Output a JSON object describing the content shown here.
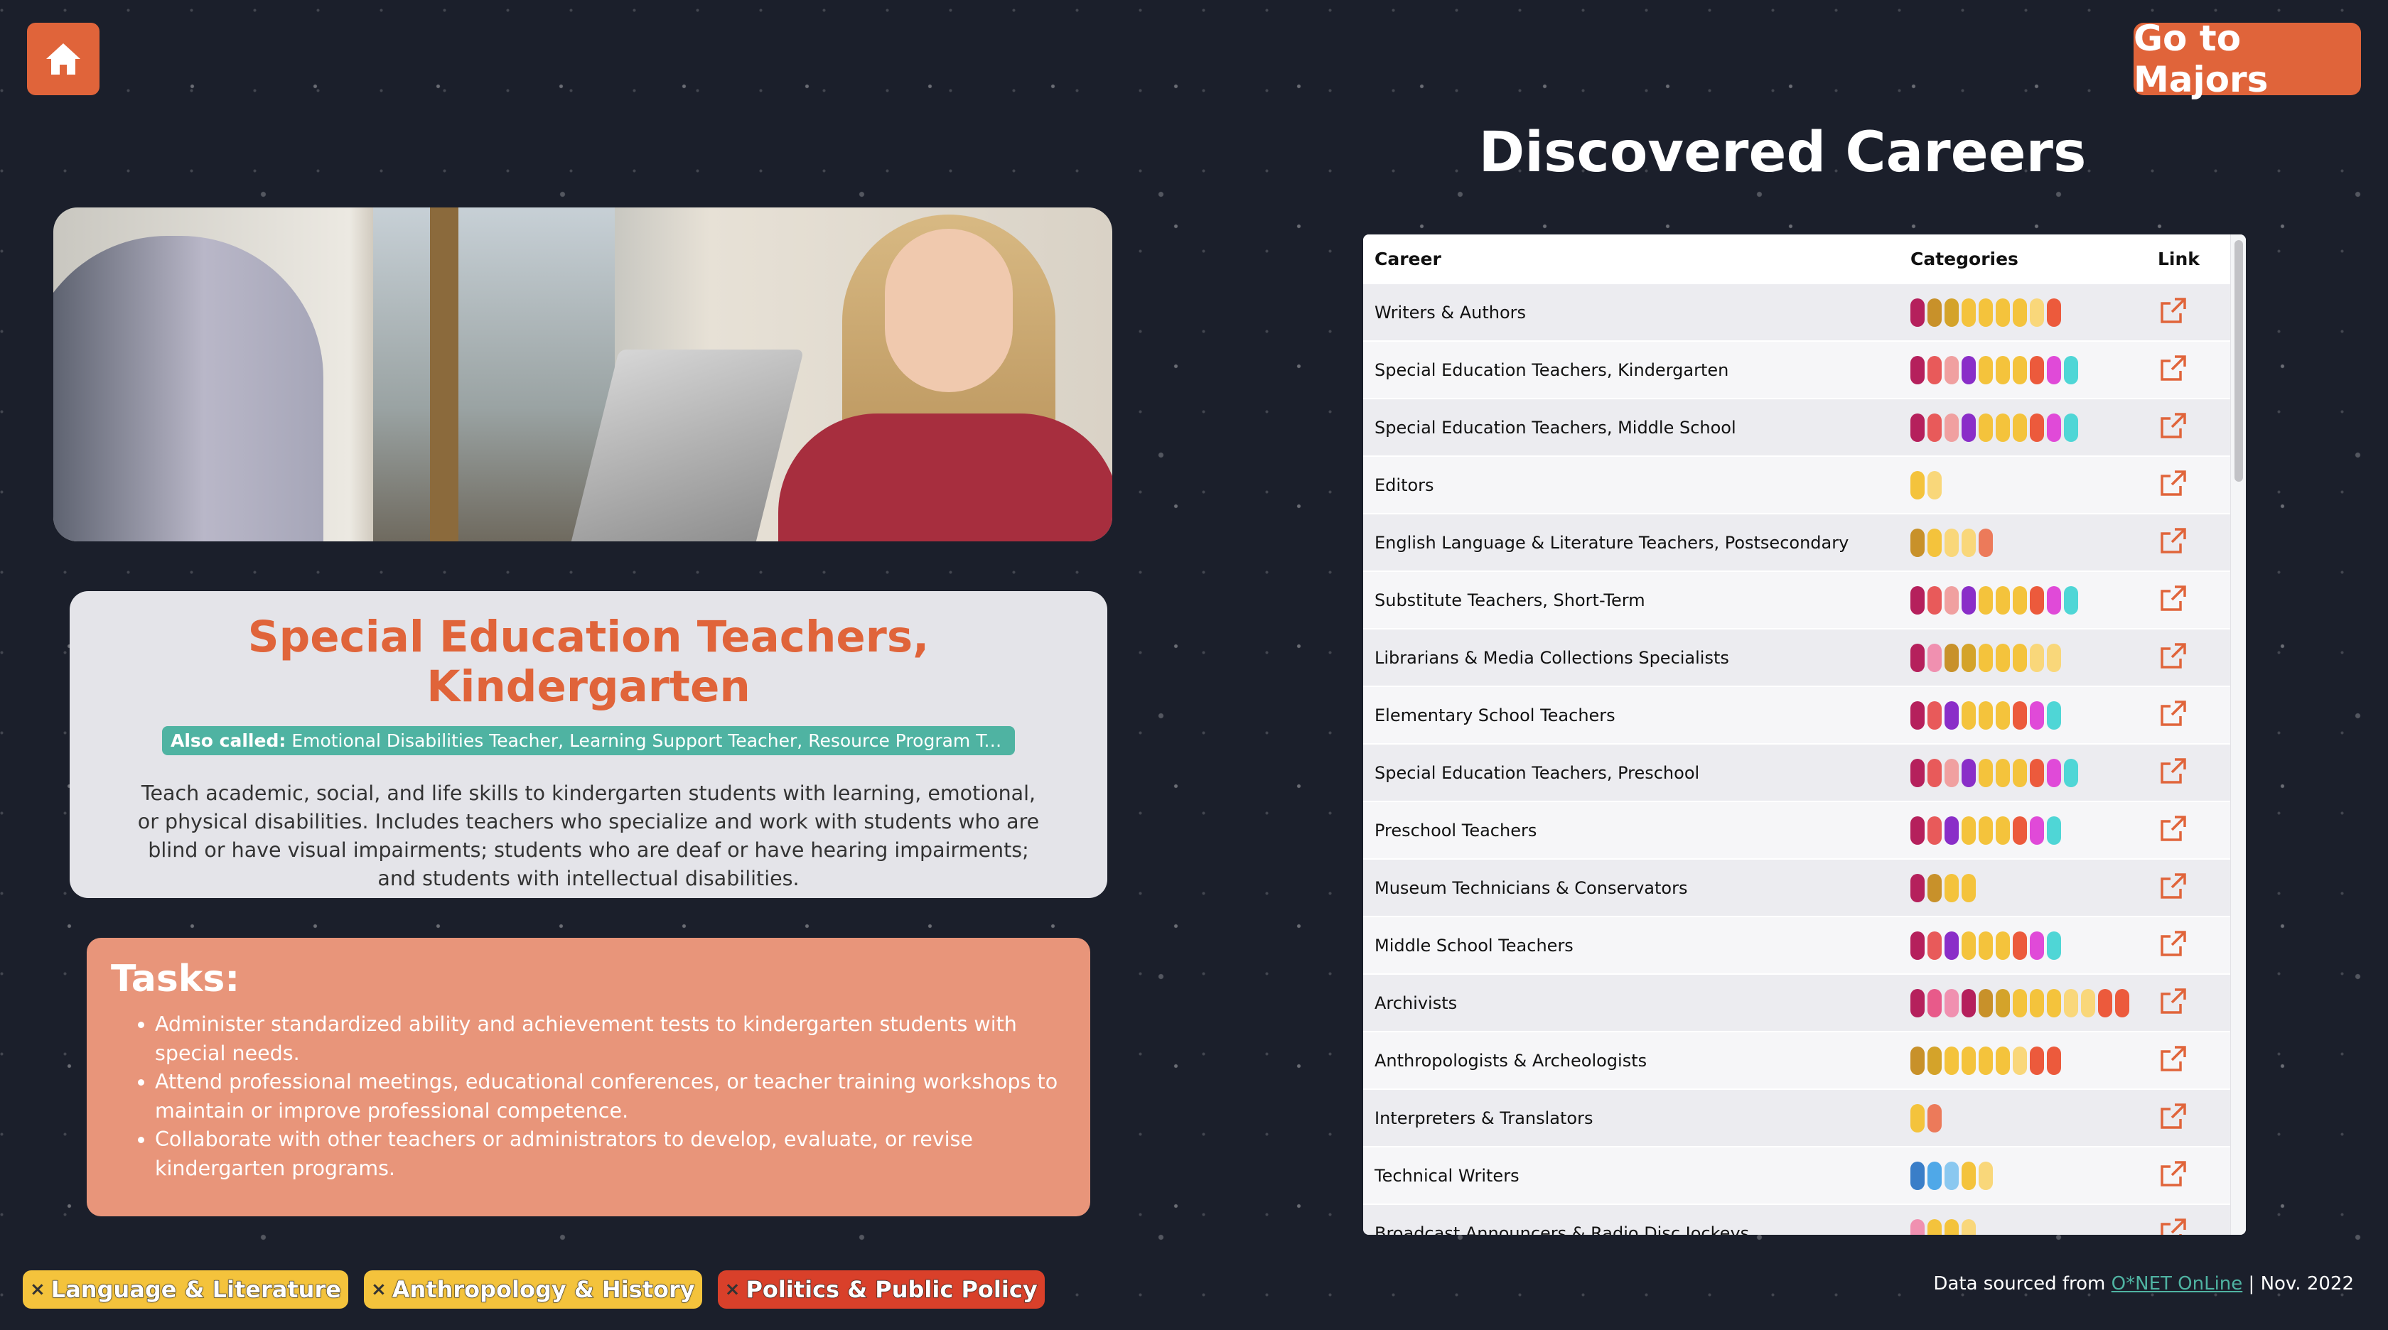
{
  "nav": {
    "home_icon": "home-icon",
    "majors_button": "Go to Majors"
  },
  "page_title": "Discovered Careers",
  "career": {
    "title": "Special Education Teachers, Kindergarten",
    "also_called_label": "Also called:",
    "also_called_value": "Emotional Disabilities Teacher, Learning Support Teacher, Resource Program Teacher...",
    "description": "Teach academic, social, and life skills to kindergarten students with learning, emotional, or physical disabilities. Includes teachers who specialize and work with students who are blind or have visual impairments; students who are deaf or have hearing impairments; and students with intellectual disabilities."
  },
  "tasks": {
    "title": "Tasks:",
    "items": [
      "Administer standardized ability and achievement tests to kindergarten students with special needs.",
      "Attend professional meetings, educational conferences, or teacher training workshops to maintain or improve professional competence.",
      "Collaborate with other teachers or administrators to develop, evaluate, or revise kindergarten programs."
    ]
  },
  "table": {
    "headers": {
      "career": "Career",
      "categories": "Categories",
      "link": "Link"
    },
    "link_icon": "external-link-icon",
    "rows": [
      {
        "career": "Writers & Authors",
        "pills": [
          "#b5205c",
          "#c8912a",
          "#d4a32a",
          "#f4c33c",
          "#f4c33c",
          "#f4c33c",
          "#f4c33c",
          "#f9d77a",
          "#ec5a3c"
        ]
      },
      {
        "career": "Special Education Teachers, Kindergarten",
        "pills": [
          "#b5205c",
          "#e85a5a",
          "#f0a0a0",
          "#8a2ec8",
          "#f4c33c",
          "#f4c33c",
          "#f4c33c",
          "#ec5a3c",
          "#e04ad8",
          "#4fd6d6"
        ]
      },
      {
        "career": "Special Education Teachers, Middle School",
        "pills": [
          "#b5205c",
          "#e85a5a",
          "#f0a0a0",
          "#8a2ec8",
          "#f4c33c",
          "#f4c33c",
          "#f4c33c",
          "#ec5a3c",
          "#e04ad8",
          "#4fd6d6"
        ]
      },
      {
        "career": "Editors",
        "pills": [
          "#f4c33c",
          "#f9d77a"
        ]
      },
      {
        "career": "English Language & Literature Teachers, Postsecondary",
        "pills": [
          "#c8912a",
          "#f4c33c",
          "#f9d77a",
          "#f9d77a",
          "#ec7a5a"
        ]
      },
      {
        "career": "Substitute Teachers, Short-Term",
        "pills": [
          "#b5205c",
          "#e85a5a",
          "#f0a0a0",
          "#8a2ec8",
          "#f4c33c",
          "#f4c33c",
          "#f4c33c",
          "#ec5a3c",
          "#e04ad8",
          "#4fd6d6"
        ]
      },
      {
        "career": "Librarians & Media Collections Specialists",
        "pills": [
          "#b5205c",
          "#f090b0",
          "#c8912a",
          "#d4a32a",
          "#f4c33c",
          "#f4c33c",
          "#f4c33c",
          "#f9d77a",
          "#f9d77a"
        ]
      },
      {
        "career": "Elementary School Teachers",
        "pills": [
          "#b5205c",
          "#e85a5a",
          "#8a2ec8",
          "#f4c33c",
          "#f4c33c",
          "#f4c33c",
          "#ec5a3c",
          "#e04ad8",
          "#4fd6d6"
        ]
      },
      {
        "career": "Special Education Teachers, Preschool",
        "pills": [
          "#b5205c",
          "#e85a5a",
          "#f0a0a0",
          "#8a2ec8",
          "#f4c33c",
          "#f4c33c",
          "#f4c33c",
          "#ec5a3c",
          "#e04ad8",
          "#4fd6d6"
        ]
      },
      {
        "career": "Preschool Teachers",
        "pills": [
          "#b5205c",
          "#e85a5a",
          "#8a2ec8",
          "#f4c33c",
          "#f4c33c",
          "#f4c33c",
          "#ec5a3c",
          "#e04ad8",
          "#4fd6d6"
        ]
      },
      {
        "career": "Museum Technicians & Conservators",
        "pills": [
          "#b5205c",
          "#c8912a",
          "#f4c33c",
          "#f4c33c"
        ]
      },
      {
        "career": "Middle School Teachers",
        "pills": [
          "#b5205c",
          "#e85a5a",
          "#8a2ec8",
          "#f4c33c",
          "#f4c33c",
          "#f4c33c",
          "#ec5a3c",
          "#e04ad8",
          "#4fd6d6"
        ]
      },
      {
        "career": "Archivists",
        "pills": [
          "#b5205c",
          "#e85a8a",
          "#f090b0",
          "#b5205c",
          "#c8912a",
          "#d4a32a",
          "#f4c33c",
          "#f4c33c",
          "#f4c33c",
          "#f9d77a",
          "#f9d77a",
          "#ec5a3c",
          "#ec5a3c"
        ]
      },
      {
        "career": "Anthropologists & Archeologists",
        "pills": [
          "#c8912a",
          "#d4a32a",
          "#f4c33c",
          "#f4c33c",
          "#f4c33c",
          "#f4c33c",
          "#f9d77a",
          "#ec5a3c",
          "#ec5a3c"
        ]
      },
      {
        "career": "Interpreters & Translators",
        "pills": [
          "#f4c33c",
          "#ec7a5a"
        ]
      },
      {
        "career": "Technical Writers",
        "pills": [
          "#3a7ec8",
          "#4fa8e8",
          "#8ac8f0",
          "#f4c33c",
          "#f9d77a"
        ]
      },
      {
        "career": "Broadcast Announcers & Radio Disc Jockeys",
        "pills": [
          "#f090b0",
          "#f4c33c",
          "#f4c33c",
          "#f9d77a"
        ]
      }
    ]
  },
  "filters": [
    {
      "label": "Language & Literature",
      "color": "#f4c33c"
    },
    {
      "label": "Anthropology & History",
      "color": "#f4c33c"
    },
    {
      "label": "Politics & Public Policy",
      "color": "#d9402a"
    }
  ],
  "footer": {
    "prefix": "Data sourced from",
    "link_text": "O*NET OnLine",
    "suffix": "| Nov. 2022"
  },
  "colors": {
    "accent": "#e0643a",
    "teal": "#4fb3a2",
    "background": "#1b1f2b"
  }
}
